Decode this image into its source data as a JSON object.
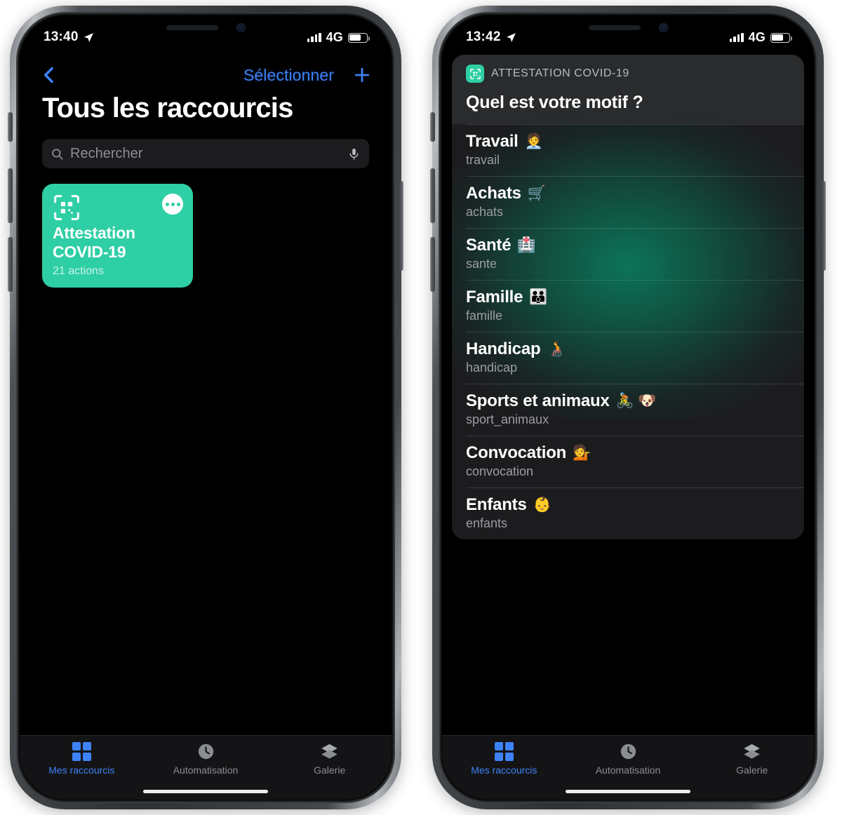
{
  "left_phone": {
    "status_bar": {
      "time": "13:40",
      "location_icon": "location-arrow-icon",
      "signal_icon": "cellular-bars-icon",
      "network": "4G",
      "battery_icon": "battery-icon"
    },
    "nav": {
      "back_icon": "chevron-left-icon",
      "select_label": "Sélectionner",
      "add_icon": "plus-icon"
    },
    "title": "Tous les raccourcis",
    "search": {
      "placeholder": "Rechercher",
      "search_icon": "search-icon",
      "mic_icon": "microphone-icon"
    },
    "shortcut_card": {
      "icon": "qr-scanner-icon",
      "more_icon": "ellipsis-icon",
      "title_line1": "Attestation",
      "title_line2": "COVID-19",
      "subtitle": "21 actions",
      "color": "#2ecfa4"
    },
    "tabs": [
      {
        "label": "Mes raccourcis",
        "icon": "grid-icon",
        "active": true
      },
      {
        "label": "Automatisation",
        "icon": "clock-icon",
        "active": false
      },
      {
        "label": "Galerie",
        "icon": "layers-icon",
        "active": false
      }
    ]
  },
  "right_phone": {
    "status_bar": {
      "time": "13:42",
      "location_icon": "location-arrow-icon",
      "signal_icon": "cellular-bars-icon",
      "network": "4G",
      "battery_icon": "battery-icon"
    },
    "menu": {
      "app_icon": "qr-scanner-icon",
      "app_name": "ATTESTATION COVID-19",
      "question": "Quel est votre motif ?",
      "options": [
        {
          "label": "Travail",
          "emoji": "🧑‍💼",
          "value": "travail"
        },
        {
          "label": "Achats",
          "emoji": "🛒",
          "value": "achats"
        },
        {
          "label": "Santé",
          "emoji": "🏥",
          "value": "sante"
        },
        {
          "label": "Famille",
          "emoji": "👪",
          "value": "famille"
        },
        {
          "label": "Handicap",
          "emoji": "🧑‍🦽",
          "value": "handicap"
        },
        {
          "label": "Sports et animaux",
          "emoji": "🚴 🐶",
          "value": "sport_animaux"
        },
        {
          "label": "Convocation",
          "emoji": "💁",
          "value": "convocation"
        },
        {
          "label": "Enfants",
          "emoji": "👶",
          "value": "enfants"
        }
      ]
    },
    "tabs": [
      {
        "label": "Mes raccourcis",
        "icon": "grid-icon",
        "active": true
      },
      {
        "label": "Automatisation",
        "icon": "clock-icon",
        "active": false
      },
      {
        "label": "Galerie",
        "icon": "layers-icon",
        "active": false
      }
    ]
  },
  "colors": {
    "accent_blue": "#3e82f7",
    "shortcut_teal": "#2ecfa4",
    "sheet_bg": "#1c1c1e",
    "screen_bg": "#000000"
  }
}
